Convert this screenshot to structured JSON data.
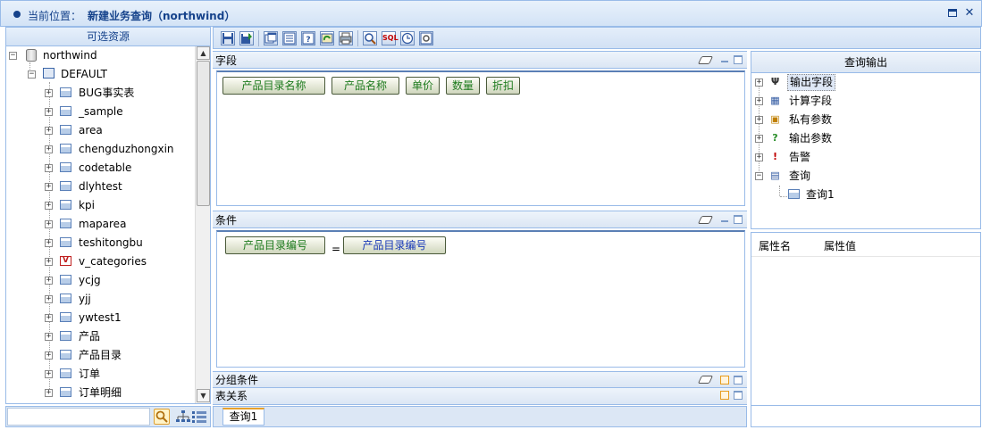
{
  "title_bar": {
    "location_label": "当前位置：",
    "page_title": "新建业务查询（northwind）",
    "maximize_icon": "maximize-icon",
    "close_glyph": "✕"
  },
  "left_panel": {
    "header": "可选资源",
    "root": "northwind",
    "schema": "DEFAULT",
    "tables": [
      {
        "label": "BUG事实表",
        "icon": "table-icon"
      },
      {
        "label": "_sample",
        "icon": "table-icon"
      },
      {
        "label": "area",
        "icon": "table-icon"
      },
      {
        "label": "chengduzhongxin",
        "icon": "table-icon"
      },
      {
        "label": "codetable",
        "icon": "table-icon"
      },
      {
        "label": "dlyhtest",
        "icon": "table-icon"
      },
      {
        "label": "kpi",
        "icon": "table-icon"
      },
      {
        "label": "maparea",
        "icon": "table-icon"
      },
      {
        "label": "teshitongbu",
        "icon": "table-icon"
      },
      {
        "label": "v_categories",
        "icon": "view-icon"
      },
      {
        "label": "ycjg",
        "icon": "table-icon"
      },
      {
        "label": "yjj",
        "icon": "table-icon"
      },
      {
        "label": "ywtest1",
        "icon": "table-icon"
      },
      {
        "label": "产品",
        "icon": "table-icon"
      },
      {
        "label": "产品目录",
        "icon": "table-icon"
      },
      {
        "label": "订单",
        "icon": "table-icon"
      },
      {
        "label": "订单明细",
        "icon": "table-icon"
      }
    ],
    "view_glyph": "V"
  },
  "toolbar": {
    "buttons": [
      "save-icon",
      "save-as-icon",
      "window-icon",
      "list-icon",
      "help-icon",
      "refresh-icon",
      "print-icon",
      "search-icon",
      "sql-icon",
      "clock-icon",
      "settings-icon"
    ],
    "sql_text": "SQL"
  },
  "fields_section": {
    "title": "字段",
    "chips": [
      "产品目录名称",
      "产品名称",
      "单价",
      "数量",
      "折扣"
    ]
  },
  "conditions_section": {
    "title": "条件",
    "left": "产品目录编号",
    "operator": "=",
    "right": "产品目录编号"
  },
  "group_section": {
    "title": "分组条件"
  },
  "relation_section": {
    "title": "表关系"
  },
  "tabs": [
    "查询1"
  ],
  "query_output": {
    "header": "查询输出",
    "items": [
      {
        "label": "输出字段",
        "icon": "filter-icon",
        "selected": true
      },
      {
        "label": "计算字段",
        "icon": "calculator-icon"
      },
      {
        "label": "私有参数",
        "icon": "parameter-icon"
      },
      {
        "label": "输出参数",
        "icon": "question-icon"
      },
      {
        "label": "告警",
        "icon": "alert-icon"
      },
      {
        "label": "查询",
        "icon": "query-icon"
      }
    ],
    "child": "查询1"
  },
  "properties": {
    "col_name": "属性名",
    "col_value": "属性值"
  },
  "colors": {
    "border": "#99bbe8",
    "title_text": "#15428b",
    "field_chip_text": "#1e7b1e",
    "condition_right_text": "#1a3ab8",
    "tab_accent": "#e7a12a"
  }
}
